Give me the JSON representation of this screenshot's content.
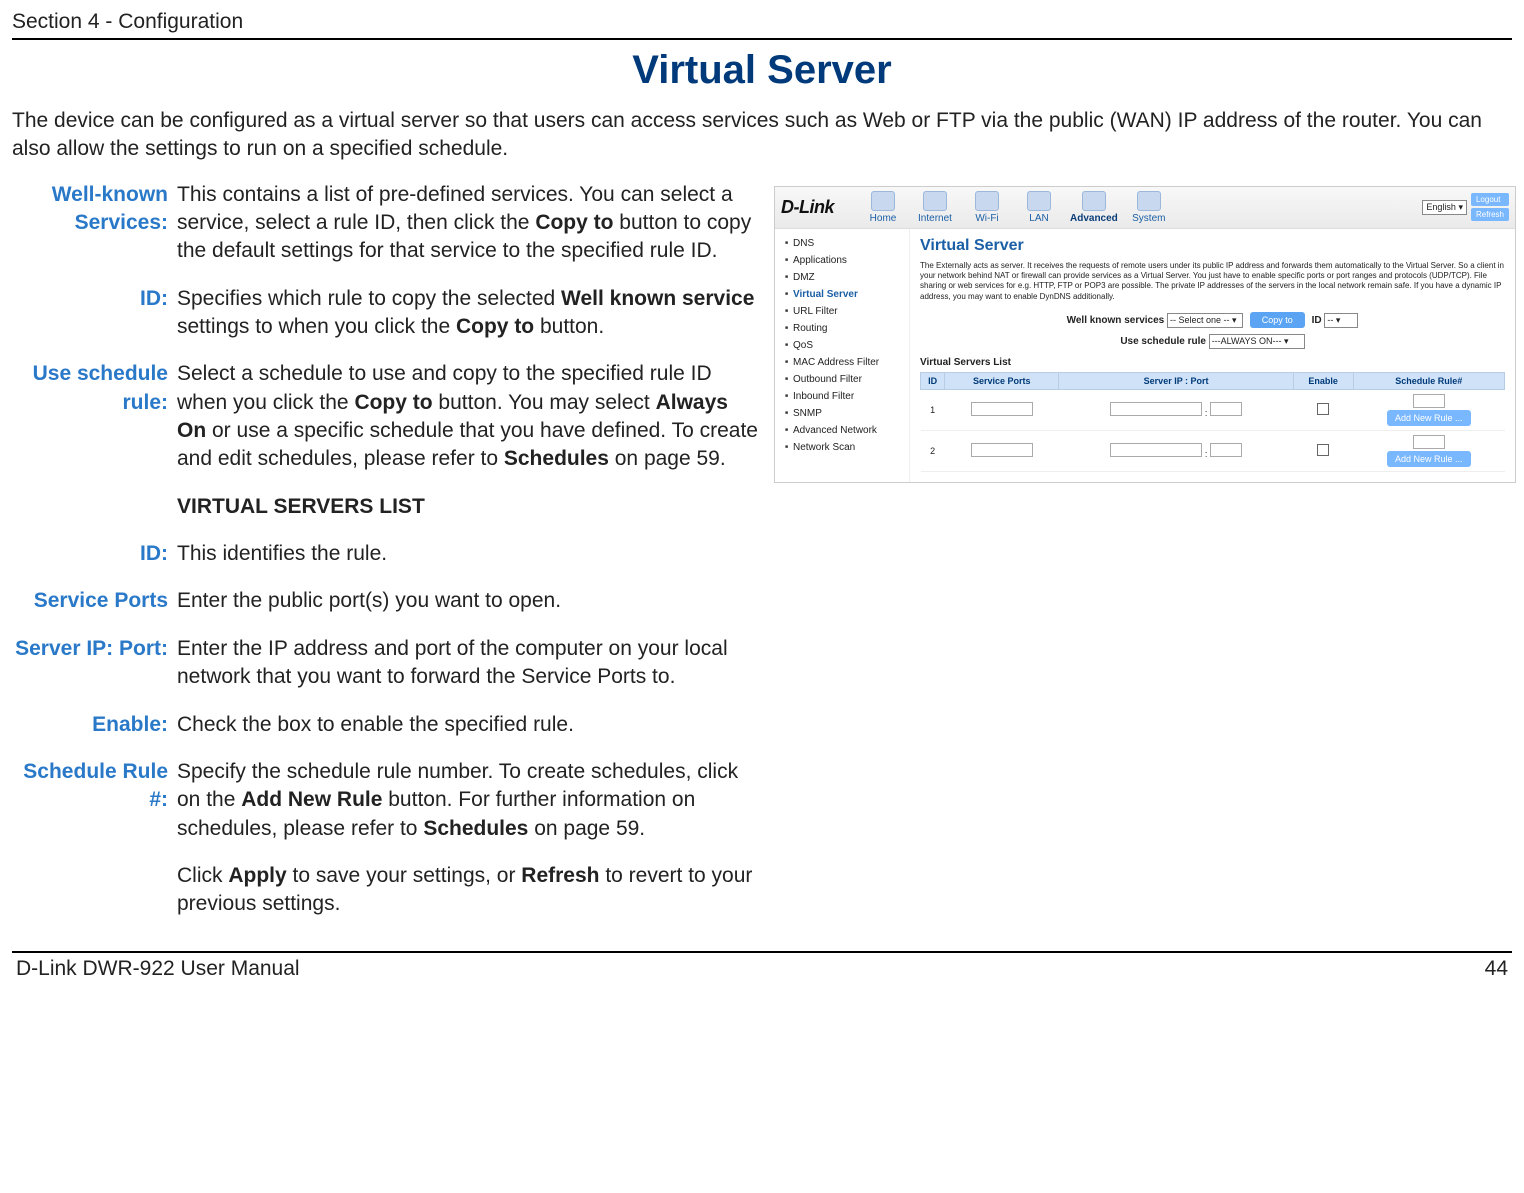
{
  "header": {
    "section": "Section 4 - Configuration"
  },
  "title": "Virtual Server",
  "intro": "The device can be configured as a virtual server so that users can access services such as Web or FTP via the public (WAN) IP address of the router. You can also allow the settings to run on a specified schedule.",
  "defs": {
    "well_known_label": "Well-known Services:",
    "well_known_desc": "This contains a list of pre-defined services. You can select a service, select a rule ID, then click the <b>Copy to</b> button to copy the default settings for that service to the specified rule ID.",
    "id1_label": "ID:",
    "id1_desc": "Specifies which rule to copy the selected <b>Well known service</b> settings to when you click the <b>Copy to</b> button.",
    "sched_label": "Use schedule rule:",
    "sched_desc": "Select a schedule to use and copy to the specified rule ID when you click the <b>Copy to</b> button. You may select <b>Always On</b> or use a specific schedule that you have defined. To create and edit schedules, please refer to <b>Schedules</b> on page 59.",
    "vsl_heading": "VIRTUAL SERVERS LIST",
    "id2_label": "ID:",
    "id2_desc": "This identifies the rule.",
    "svcports_label": "Service Ports",
    "svcports_desc": "Enter the public port(s) you want to open.",
    "ipport_label": "Server IP: Port:",
    "ipport_desc": "Enter the IP address and port of the computer on your local network that you want to forward the Service Ports to.",
    "enable_label": "Enable:",
    "enable_desc": "Check the box to enable the specified rule.",
    "srule_label": "Schedule Rule #:",
    "srule_desc": "Specify the schedule rule number. To create schedules, click on the <b>Add New Rule</b> button. For further information on schedules, please refer to <b>Schedules</b> on page 59.",
    "apply_desc": "Click <b>Apply</b> to save your settings, or <b>Refresh</b> to revert to your previous settings."
  },
  "ui": {
    "logo": "D-Link",
    "nav": [
      "Home",
      "Internet",
      "Wi-Fi",
      "LAN",
      "Advanced",
      "System"
    ],
    "lang": "English",
    "logout": "Logout",
    "refresh": "Refresh",
    "side": [
      "DNS",
      "Applications",
      "DMZ",
      "Virtual Server",
      "URL Filter",
      "Routing",
      "QoS",
      "MAC Address Filter",
      "Outbound Filter",
      "Inbound Filter",
      "SNMP",
      "Advanced Network",
      "Network Scan"
    ],
    "panel_title": "Virtual Server",
    "panel_desc": "The Externally acts as server. It receives the requests of remote users under its public IP address and forwards them automatically to the Virtual Server. So a client in your network behind NAT or firewall can provide services as a Virtual Server. You just have to enable specific ports or port ranges and protocols (UDP/TCP). File sharing or web services for e.g. HTTP, FTP or POP3 are possible. The private IP addresses of the servers in the local network remain safe. If you have a dynamic IP address, you may want to enable DynDNS additionally.",
    "wks_label": "Well known services",
    "wks_select": "-- Select one --",
    "copy_to": "Copy to",
    "id_label": "ID",
    "id_select": "--",
    "usr_label": "Use schedule rule",
    "usr_select": "---ALWAYS ON---",
    "list_heading": "Virtual Servers List",
    "cols": [
      "ID",
      "Service Ports",
      "Server IP : Port",
      "Enable",
      "Schedule Rule#"
    ],
    "rows": [
      {
        "id": "1"
      },
      {
        "id": "2"
      }
    ],
    "add_rule": "Add New Rule ..."
  },
  "footer": {
    "left": "D-Link DWR-922 User Manual",
    "right": "44"
  }
}
